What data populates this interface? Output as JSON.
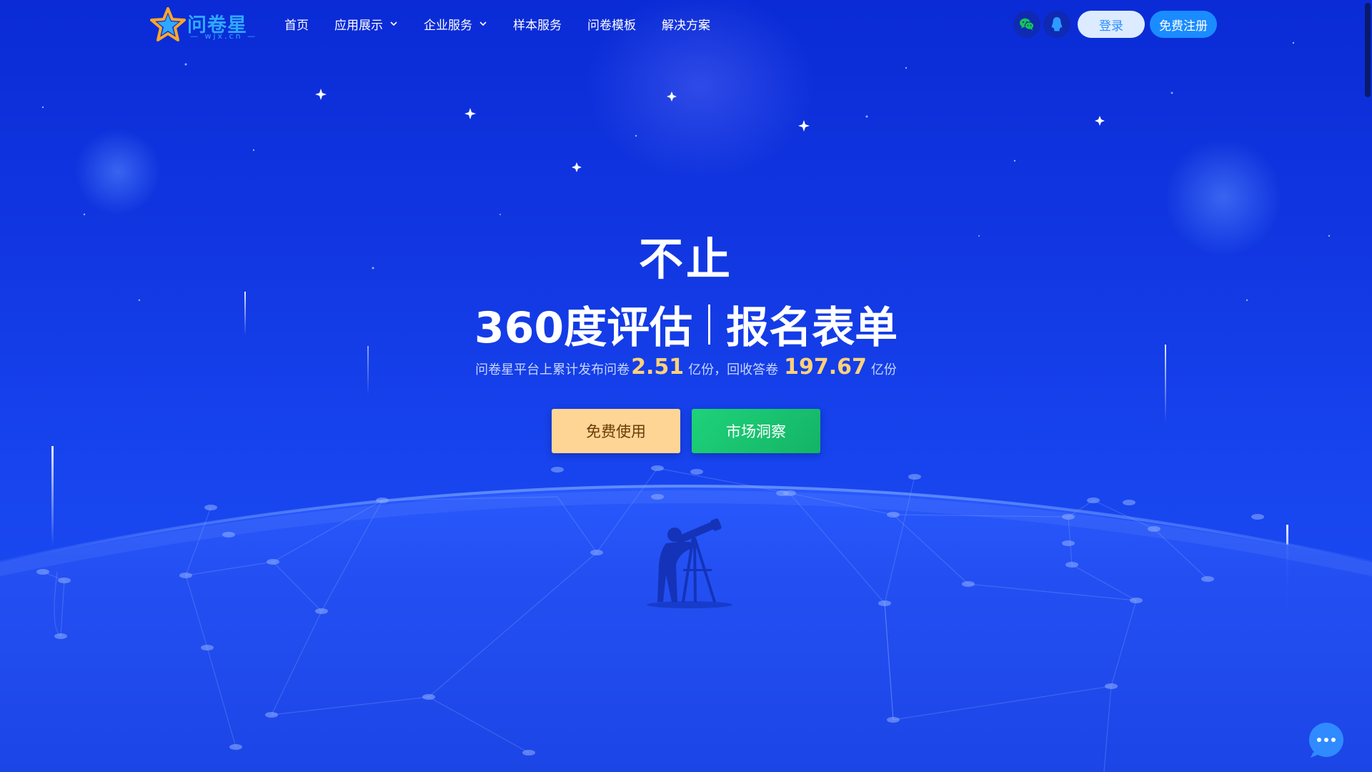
{
  "brand": {
    "name": "问卷星",
    "domain": "— wjx.cn —"
  },
  "nav": {
    "items": [
      {
        "label": "首页",
        "has_dropdown": false
      },
      {
        "label": "应用展示",
        "has_dropdown": true
      },
      {
        "label": "企业服务",
        "has_dropdown": true
      },
      {
        "label": "样本服务",
        "has_dropdown": false
      },
      {
        "label": "问卷模板",
        "has_dropdown": false
      },
      {
        "label": "解决方案",
        "has_dropdown": false
      }
    ]
  },
  "header": {
    "icons": [
      "wechat-icon",
      "qq-icon"
    ],
    "login_label": "登录",
    "register_label": "免费注册"
  },
  "hero": {
    "line1": "不止",
    "line2_left": "360度评估",
    "line2_right": "报名表单",
    "stats": {
      "prefix": "问卷星平台上累计发布问卷",
      "published": "2.51",
      "unit1": "亿份，回收答卷",
      "answers": "197.67",
      "unit2": "亿份"
    },
    "free_button": "免费使用",
    "market_button": "市场洞察"
  },
  "colors": {
    "background": "#1238e3",
    "accent_blue": "#1a8cff",
    "login_bg": "#dcebff",
    "free_button_bg": "#ffd596",
    "market_button_bg": "#1fd27a",
    "stat_number": "#ffd27a"
  }
}
